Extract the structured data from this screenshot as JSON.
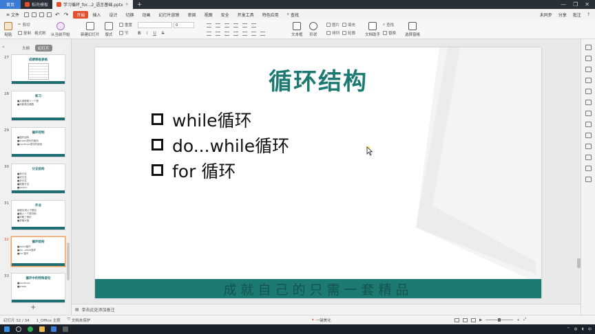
{
  "tabs": [
    {
      "label": "首页",
      "kind": "home"
    },
    {
      "label": "稻壳模板",
      "kind": "normal",
      "color": "#e2502e"
    },
    {
      "label": "学习循环_for...2_语言基础.pptx",
      "kind": "active",
      "color": "#e2502e"
    }
  ],
  "menu": {
    "file": "文件",
    "items": [
      "开始",
      "插入",
      "设计",
      "切换",
      "动画",
      "幻灯片放映",
      "审阅",
      "视图",
      "安全",
      "开发工具",
      "特色应用"
    ],
    "active": "开始",
    "search": "查找",
    "right": [
      "未同步",
      "分享",
      "批注"
    ]
  },
  "ribbon": {
    "paste": "粘贴",
    "cut": "剪切",
    "copy": "复制",
    "format_painter": "格式刷",
    "from_current": "从当前开始",
    "new_slide": "新建幻灯片",
    "layout": "版式",
    "reset": "重置",
    "section": "节",
    "font_size": "0",
    "textbox": "文本框",
    "shape": "形状",
    "arrange": "排列",
    "picture": "图片",
    "fill": "填充",
    "outline": "轮廓",
    "find": "查找",
    "replace": "替换",
    "doc_helper": "文档助手",
    "select_pane": "选择窗格",
    "bold": "B",
    "italic": "I",
    "underline": "U",
    "strike": "S"
  },
  "left_panel": {
    "tab_outline": "大纲",
    "tab_slides": "幻灯片",
    "add": "+",
    "thumbnails": [
      {
        "num": "27",
        "title": "成绩等级表格",
        "lines": [],
        "has_table": true
      },
      {
        "num": "28",
        "title": "练习",
        "lines": [
          "■从键盘输入一个数",
          "■判断是否偶数"
        ]
      },
      {
        "num": "29",
        "title": "循环控制",
        "lines": [
          "■循环结构",
          "■break语句的使用",
          "■continue语句的使用"
        ]
      },
      {
        "num": "30",
        "title": "分支结构",
        "lines": [
          "■单分支",
          "■双分支",
          "■多分支",
          "■嵌套分支",
          "■switch",
          "■switch_case"
        ]
      },
      {
        "num": "31",
        "title": "作业",
        "lines": [
          "编程实现以下题目",
          "■输入一个数判断",
          "■判断三角形",
          "■求最大值"
        ]
      },
      {
        "num": "32",
        "title": "循环结构",
        "lines": [
          "■while循环",
          "■do...while循环",
          "■for 循环"
        ],
        "selected": true
      },
      {
        "num": "33",
        "title": "循环中的特殊语句",
        "lines": [
          "■continue",
          "■break"
        ]
      }
    ]
  },
  "slide": {
    "title": "循环结构",
    "bullets": [
      "while循环",
      "do...while循环",
      "for 循环"
    ],
    "footer": "成就自己的只需一套精品",
    "accent": "#1c7a72"
  },
  "notes": {
    "placeholder": "单击此处添加备注"
  },
  "status": {
    "slide_counter": "幻灯片 32 / 34",
    "theme": "1_Office 主题",
    "protect": "文档未保护",
    "beautify": "一键美化"
  }
}
